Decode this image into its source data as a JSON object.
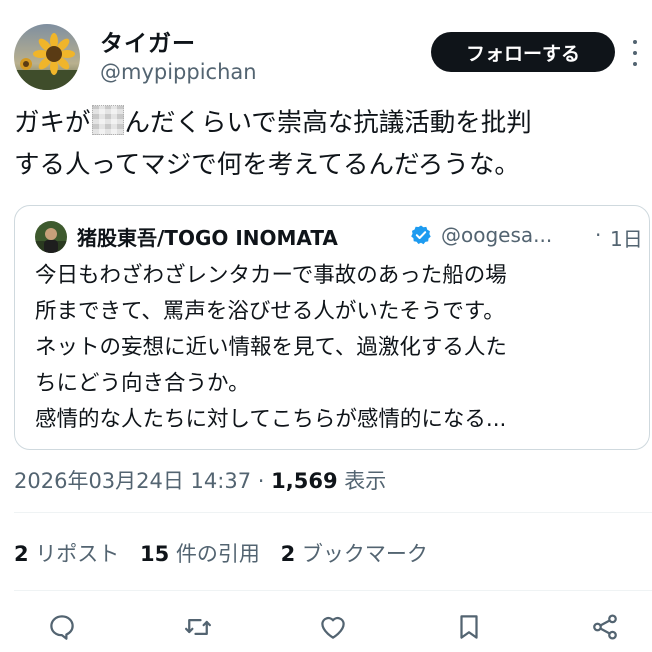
{
  "author": {
    "name": "タイガー",
    "handle": "@mypippichan"
  },
  "follow_label": "フォローする",
  "tweet": {
    "line1_before": "ガキが",
    "line1_after": "んだくらいで崇高な抗議活動を批判",
    "line2": "する人ってマジで何を考えてるんだろうな。"
  },
  "quote": {
    "name": "猪股東吾/TOGO INOMATA",
    "handle": "@oogesa...",
    "dot": "·",
    "time": "1日",
    "lines": [
      "今日もわざわざレンタカーで事故のあった船の場",
      "所まできて、罵声を浴びせる人がいたそうです。",
      "ネットの妄想に近い情報を見て、過激化する人た",
      "ちにどう向き合うか。",
      "感情的な人たちに対してこちらが感情的になる..."
    ]
  },
  "meta": {
    "datetime": "2026年03月24日 14:37",
    "sep": "·",
    "views": "1,569",
    "views_label": "表示"
  },
  "stats": {
    "reposts": "2",
    "reposts_label": "リポスト",
    "quotes": "15",
    "quotes_label": "件の引用",
    "bookmarks": "2",
    "bookmarks_label": "ブックマーク"
  },
  "icons": {
    "reply": "reply-icon",
    "repost": "repost-icon",
    "like": "like-icon",
    "bookmark": "bookmark-icon",
    "share": "share-icon",
    "verified": "verified-badge-icon"
  },
  "colors": {
    "text": "#0f1419",
    "secondary": "#536471",
    "button_bg": "#0f1419",
    "verified": "#1d9bf0",
    "border": "#cfd9de"
  }
}
